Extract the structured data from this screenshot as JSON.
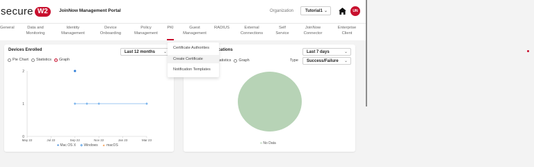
{
  "header": {
    "logo_text": "secure",
    "logo_badge": "W2",
    "portal_title": "JoinNow Management Portal",
    "org_label": "Organization",
    "org_value": "Tutorial1",
    "avatar_initials": "UN"
  },
  "nav": {
    "items": [
      {
        "label": "General"
      },
      {
        "label": "Data and\nMonitoring"
      },
      {
        "label": "Identity\nManagement"
      },
      {
        "label": "Device\nOnboarding"
      },
      {
        "label": "Policy\nManagement"
      },
      {
        "label": "PKI"
      },
      {
        "label": "Guest\nManagement"
      },
      {
        "label": "RADIUS"
      },
      {
        "label": "External\nConnections"
      },
      {
        "label": "Self\nService"
      },
      {
        "label": "JoinNow\nConnector"
      },
      {
        "label": "Enterprise\nClient"
      }
    ]
  },
  "pki_menu": {
    "items": [
      "Certificate Authorities",
      "Create Certificate",
      "Notification Templates"
    ]
  },
  "devices_card": {
    "title": "Devices Enrolled",
    "period": "Last 12 months",
    "radios": [
      "Pie Chart",
      "Statistics",
      "Graph"
    ],
    "selected_radio": "Graph"
  },
  "auth_card": {
    "title_partial": "ications",
    "period": "Last 7 days",
    "radios_partial": [
      "tatistics",
      "Graph"
    ],
    "type_label": "Type",
    "type_value": "Success/Failure",
    "no_data": "No Data"
  },
  "colors": {
    "brand": "#c8102e",
    "macosx": "#2f7ed8",
    "windows": "#7cb5ec",
    "macos": "#f7a35c",
    "pie": "#b7d3b6"
  },
  "chart_data": {
    "type": "line",
    "x": [
      "May 22",
      "Jul 22",
      "Sep 22",
      "Nov 22",
      "Jan 23",
      "Mar 23"
    ],
    "ylim": [
      0,
      2
    ],
    "yticks": [
      "0",
      "1",
      "2"
    ],
    "series": [
      {
        "name": "Mac OS X",
        "points": [
          {
            "x": "Sep 22",
            "y": 2
          }
        ]
      },
      {
        "name": "Windows",
        "points": [
          {
            "x": "Sep 22",
            "y": 1
          },
          {
            "x": "Oct 22",
            "y": 1
          },
          {
            "x": "Nov 22",
            "y": 1
          },
          {
            "x": "Mar 23",
            "y": 1
          }
        ]
      },
      {
        "name": "macOS",
        "points": []
      }
    ]
  }
}
